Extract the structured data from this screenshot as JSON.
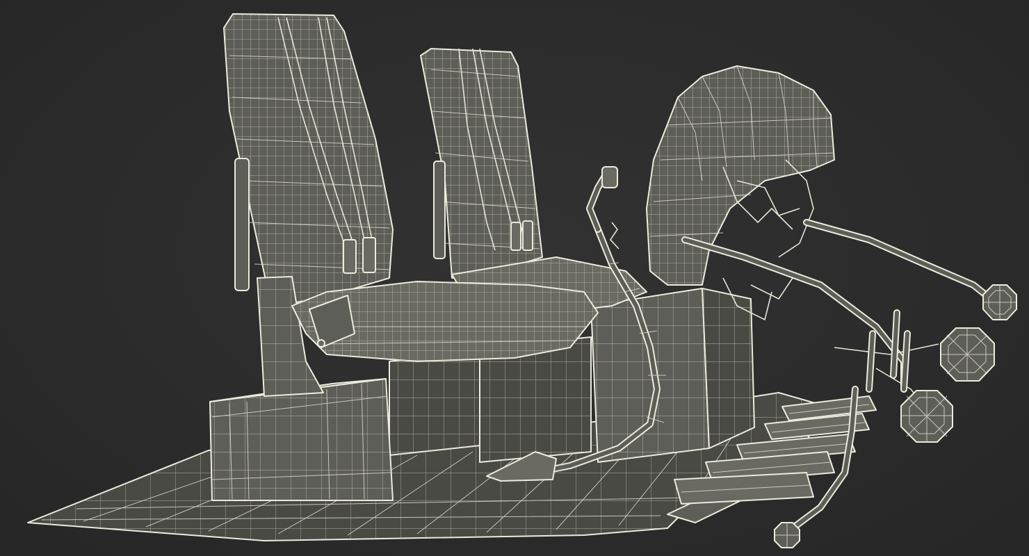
{
  "scene": {
    "background_color": "#2b2b2b",
    "model_fill_color": "#5e5e58",
    "wireframe_color": "#ecebdc"
  },
  "parts": {
    "floor": "floor-plate",
    "seats": [
      "left-seat",
      "right-seat"
    ],
    "control_stick": "control-stick",
    "instrument_panel": "instrument-panel",
    "pedals": "rudder-pedals",
    "mirrors": [
      "mirror-upper",
      "mirror-middle",
      "mirror-lower",
      "mirror-bottom"
    ]
  }
}
